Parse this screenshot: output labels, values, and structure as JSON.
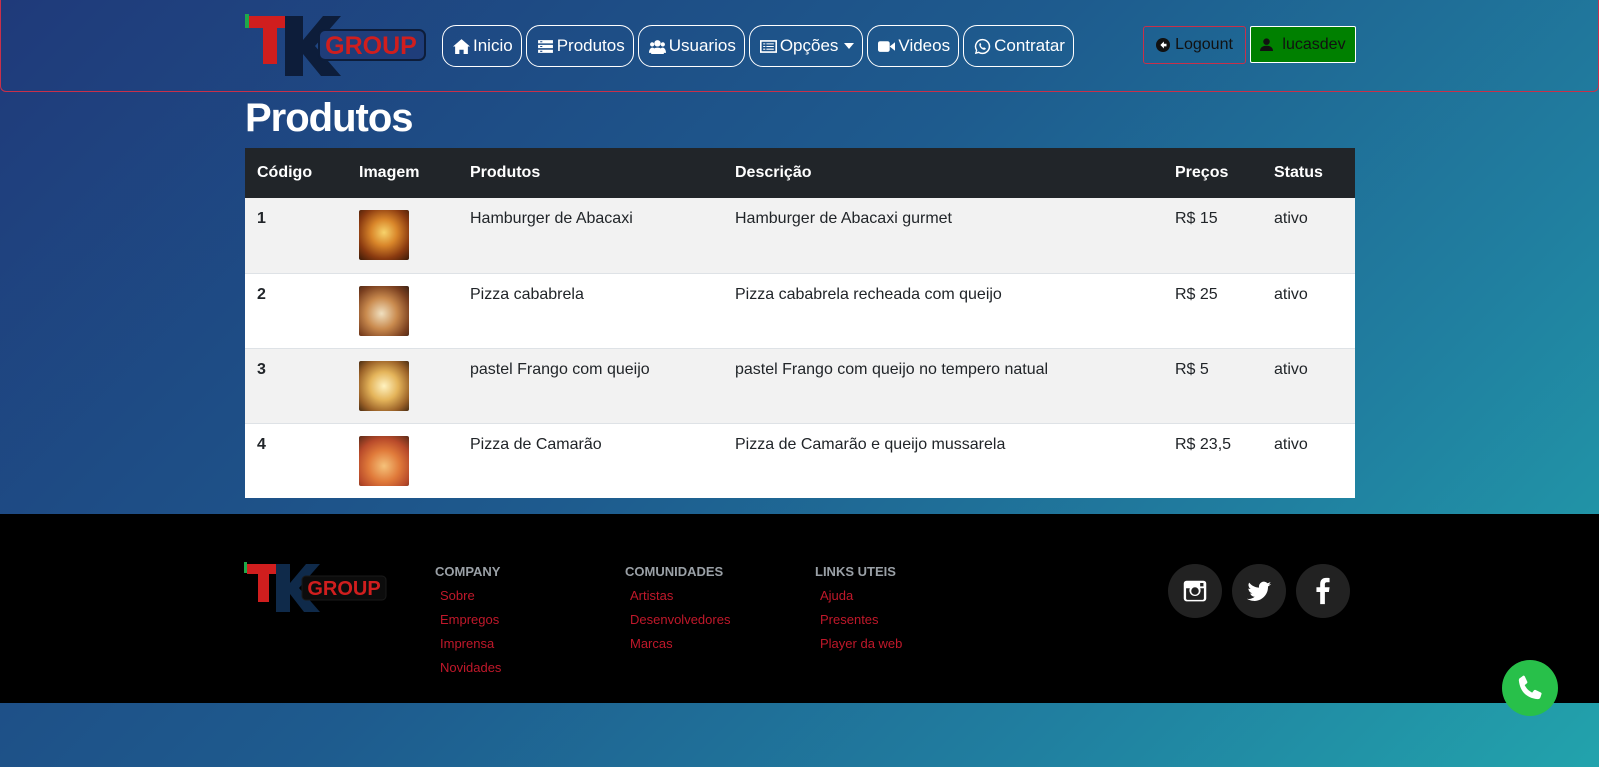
{
  "brand": {
    "logo_letters": "TK",
    "logo_word": "GROUP",
    "colors": {
      "red": "#d01e1e",
      "green": "#1fa84a",
      "dark": "#0d1d3a"
    }
  },
  "nav": {
    "items": [
      {
        "label": "Inicio",
        "icon": "home-icon"
      },
      {
        "label": "Produtos",
        "icon": "list-icon"
      },
      {
        "label": "Usuarios",
        "icon": "users-icon"
      },
      {
        "label": "Opções",
        "icon": "options-icon",
        "dropdown": true
      },
      {
        "label": "Videos",
        "icon": "video-icon"
      },
      {
        "label": "Contratar",
        "icon": "whatsapp-icon"
      }
    ],
    "logout_label": "Logount",
    "user_label": "lucasdev"
  },
  "page": {
    "title": "Produtos"
  },
  "table": {
    "headers": [
      "Código",
      "Imagem",
      "Produtos",
      "Descrição",
      "Preços",
      "Status"
    ],
    "rows": [
      {
        "code": "1",
        "image": "hamburger-thumbnail",
        "product": "Hamburger de Abacaxi",
        "description": "Hamburger de Abacaxi gurmet",
        "price": "R$ 15",
        "status": "ativo"
      },
      {
        "code": "2",
        "image": "pizza-thumbnail",
        "product": "Pizza cababrela",
        "description": "Pizza cababrela recheada com queijo",
        "price": "R$ 25",
        "status": "ativo"
      },
      {
        "code": "3",
        "image": "pastel-thumbnail",
        "product": "pastel Frango com queijo",
        "description": "pastel Frango com queijo no tempero natual",
        "price": "R$ 5",
        "status": "ativo"
      },
      {
        "code": "4",
        "image": "shrimp-pizza-thumbnail",
        "product": "Pizza de Camarão",
        "description": "Pizza de Camarão e queijo mussarela",
        "price": "R$ 23,5",
        "status": "ativo"
      }
    ]
  },
  "footer": {
    "columns": [
      {
        "title": "COMPANY",
        "links": [
          "Sobre",
          "Empregos",
          "Imprensa",
          "Novidades"
        ]
      },
      {
        "title": "COMUNIDADES",
        "links": [
          "Artistas",
          "Desenvolvedores",
          "Marcas"
        ]
      },
      {
        "title": "LINKS UTEIS",
        "links": [
          "Ajuda",
          "Presentes",
          "Player da web"
        ]
      }
    ],
    "social": [
      "instagram-icon",
      "twitter-icon",
      "facebook-icon"
    ]
  },
  "floating": {
    "icon": "whatsapp-icon"
  }
}
